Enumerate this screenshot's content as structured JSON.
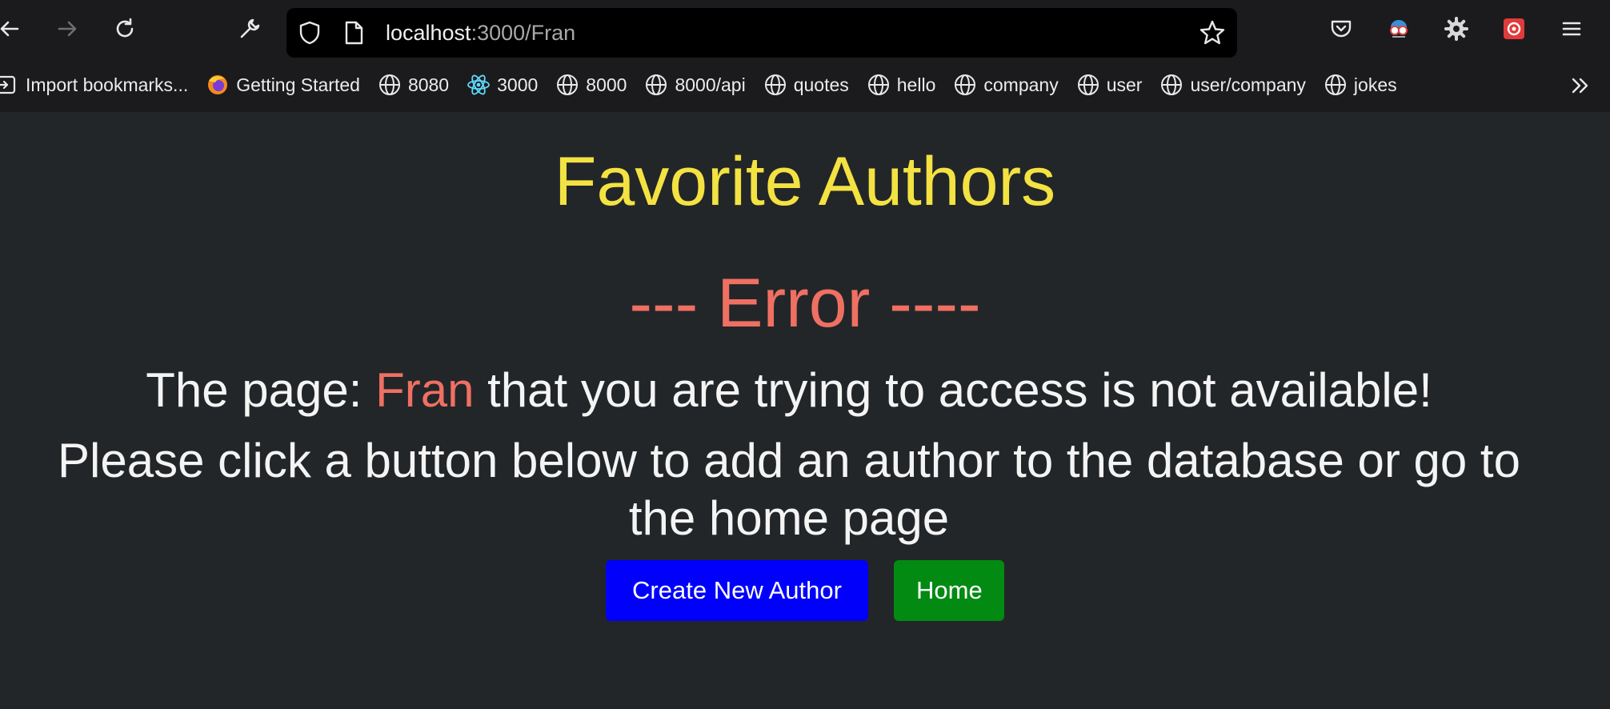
{
  "browser": {
    "url_host": "localhost",
    "url_path": ":3000/Fran",
    "bookmarks": [
      {
        "label": "Import bookmarks...",
        "icon": "import-icon"
      },
      {
        "label": "Getting Started",
        "icon": "firefox-icon"
      },
      {
        "label": "8080",
        "icon": "globe-icon"
      },
      {
        "label": "3000",
        "icon": "react-icon"
      },
      {
        "label": "8000",
        "icon": "globe-icon"
      },
      {
        "label": "8000/api",
        "icon": "globe-icon"
      },
      {
        "label": "quotes",
        "icon": "globe-icon"
      },
      {
        "label": "hello",
        "icon": "globe-icon"
      },
      {
        "label": "company",
        "icon": "globe-icon"
      },
      {
        "label": "user",
        "icon": "globe-icon"
      },
      {
        "label": "user/company",
        "icon": "globe-icon"
      },
      {
        "label": "jokes",
        "icon": "globe-icon"
      }
    ]
  },
  "page": {
    "title": "Favorite Authors",
    "error_heading": "--- Error ----",
    "message_prefix": "The page: ",
    "requested_page": "Fran",
    "message_suffix": " that you are trying to access is not available!",
    "instruction": "Please click a button below to add an author to the database or go to the home page",
    "create_button": "Create New Author",
    "home_button": "Home"
  },
  "colors": {
    "title": "#f3e242",
    "error": "#ef7063",
    "create_button": "#0100fb",
    "home_button": "#028a12",
    "background": "#232628"
  }
}
